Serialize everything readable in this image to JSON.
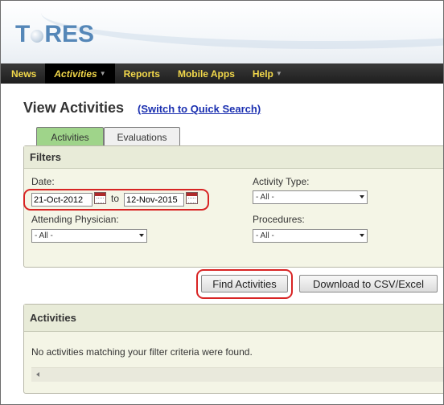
{
  "logo": {
    "text_left": "T",
    "text_right": "RES"
  },
  "nav": {
    "items": [
      {
        "label": "News"
      },
      {
        "label": "Activities"
      },
      {
        "label": "Reports"
      },
      {
        "label": "Mobile Apps"
      },
      {
        "label": "Help"
      }
    ]
  },
  "page": {
    "title": "View Activities",
    "switch_link": "(Switch to Quick Search)"
  },
  "tabs": [
    {
      "label": "Activities"
    },
    {
      "label": "Evaluations"
    }
  ],
  "filters": {
    "heading": "Filters",
    "date_label": "Date:",
    "date_from": "21-Oct-2012",
    "date_to_word": "to",
    "date_to": "12-Nov-2015",
    "activity_type_label": "Activity Type:",
    "activity_type_value": "- All -",
    "attending_label": "Attending Physician:",
    "attending_value": "- All -",
    "procedures_label": "Procedures:",
    "procedures_value": "- All -"
  },
  "buttons": {
    "find": "Find Activities",
    "download": "Download to CSV/Excel"
  },
  "activities": {
    "heading": "Activities",
    "empty_message": "No activities matching your filter criteria were found."
  },
  "colors": {
    "nav_text": "#f2d84a",
    "active_tab": "#9fd48a",
    "highlight_ring": "#d82424",
    "link": "#1a2fb0"
  }
}
